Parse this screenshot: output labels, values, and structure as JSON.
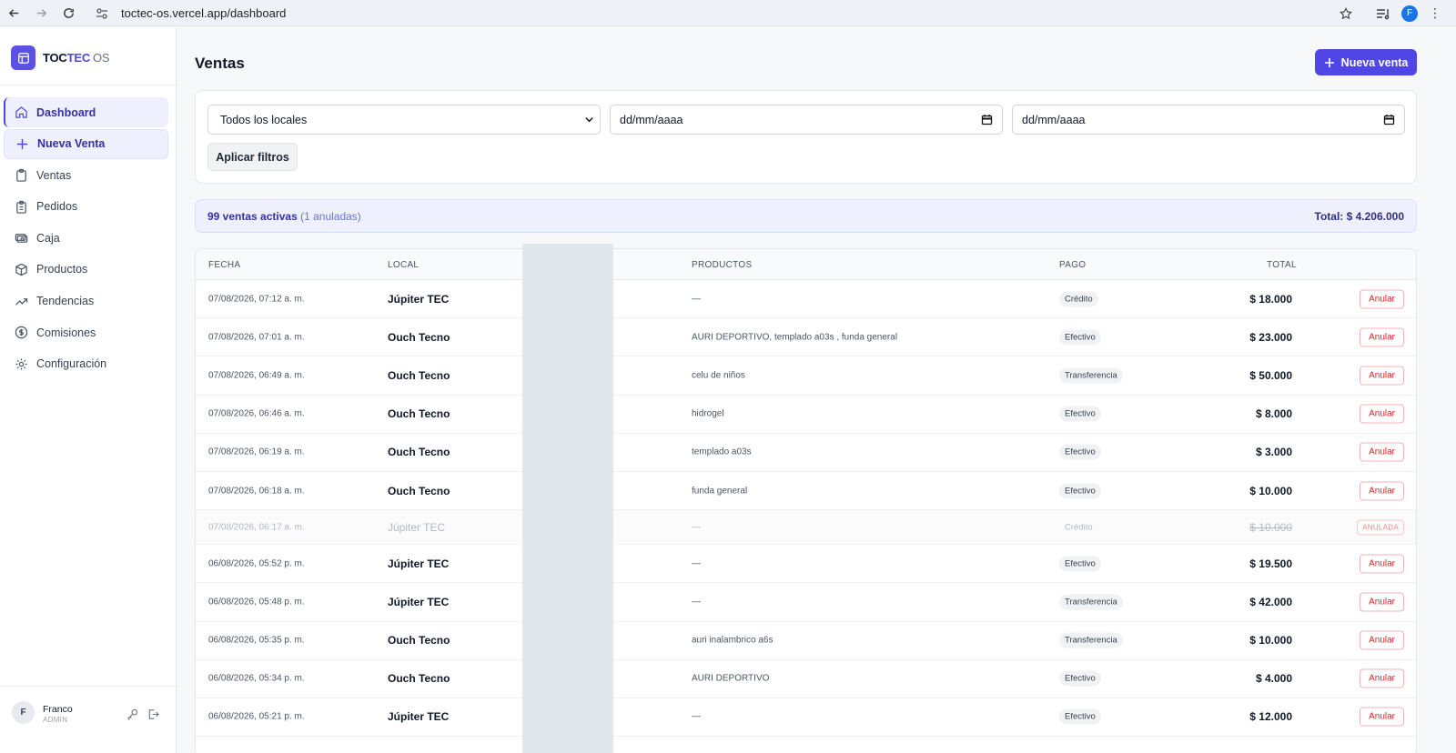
{
  "browser": {
    "url": "toctec-os.vercel.app/dashboard",
    "profile_initial": "F"
  },
  "brand": {
    "name_a": "TOC",
    "name_b": "TEC",
    "suffix": "OS"
  },
  "sidebar": {
    "items": [
      {
        "label": "Dashboard",
        "icon": "home-icon"
      },
      {
        "label": "Nueva Venta",
        "icon": "plus-icon"
      },
      {
        "label": "Ventas",
        "icon": "clipboard-icon"
      },
      {
        "label": "Pedidos",
        "icon": "clipboard-list-icon"
      },
      {
        "label": "Caja",
        "icon": "cash-icon"
      },
      {
        "label": "Productos",
        "icon": "box-icon"
      },
      {
        "label": "Tendencias",
        "icon": "trending-icon"
      },
      {
        "label": "Comisiones",
        "icon": "dollar-circle-icon"
      },
      {
        "label": "Configuración",
        "icon": "gear-icon"
      }
    ],
    "user": {
      "initial": "F",
      "name": "Franco",
      "role": "ADMIN"
    }
  },
  "page": {
    "title": "Ventas",
    "new_sale_label": "Nueva venta"
  },
  "filters": {
    "local_select": "Todos los locales",
    "date_from": "dd/mm/aaaa",
    "date_to": "dd/mm/aaaa",
    "apply_label": "Aplicar filtros"
  },
  "summary": {
    "count_text": "99 ventas activas",
    "voided_text": "(1 anuladas)",
    "total_text": "Total: $ 4.206.000"
  },
  "table": {
    "headers": {
      "date": "FECHA",
      "local": "LOCAL",
      "products": "PRODUCTOS",
      "payment": "PAGO",
      "total": "TOTAL"
    },
    "action_label": "Anular",
    "voided_label": "ANULADA",
    "rows": [
      {
        "date": "07/08/2026, 07:12 a. m.",
        "local": "Júpiter TEC",
        "products": "—",
        "payment": "Crédito",
        "total": "$ 18.000"
      },
      {
        "date": "07/08/2026, 07:01 a. m.",
        "local": "Ouch Tecno",
        "products": "AURI DEPORTIVO, templado a03s , funda general",
        "payment": "Efectivo",
        "total": "$ 23.000"
      },
      {
        "date": "07/08/2026, 06:49 a. m.",
        "local": "Ouch Tecno",
        "products": "celu de niños",
        "payment": "Transferencia",
        "total": "$ 50.000"
      },
      {
        "date": "07/08/2026, 06:46 a. m.",
        "local": "Ouch Tecno",
        "products": "hidrogel",
        "payment": "Efectivo",
        "total": "$ 8.000"
      },
      {
        "date": "07/08/2026, 06:19 a. m.",
        "local": "Ouch Tecno",
        "products": "templado a03s",
        "payment": "Efectivo",
        "total": "$ 3.000"
      },
      {
        "date": "07/08/2026, 06:18 a. m.",
        "local": "Ouch Tecno",
        "products": "funda general",
        "payment": "Efectivo",
        "total": "$ 10.000"
      },
      {
        "date": "07/08/2026, 06:17 a. m.",
        "local": "Júpiter TEC",
        "products": "—",
        "payment": "Crédito",
        "total": "$ 10.000"
      },
      {
        "date": "06/08/2026, 05:52 p. m.",
        "local": "Júpiter TEC",
        "products": "—",
        "payment": "Efectivo",
        "total": "$ 19.500"
      },
      {
        "date": "06/08/2026, 05:48 p. m.",
        "local": "Júpiter TEC",
        "products": "—",
        "payment": "Transferencia",
        "total": "$ 42.000"
      },
      {
        "date": "06/08/2026, 05:35 p. m.",
        "local": "Ouch Tecno",
        "products": "auri inalambrico a6s",
        "payment": "Transferencia",
        "total": "$ 10.000"
      },
      {
        "date": "06/08/2026, 05:34 p. m.",
        "local": "Ouch Tecno",
        "products": "AURI DEPORTIVO",
        "payment": "Efectivo",
        "total": "$ 4.000"
      },
      {
        "date": "06/08/2026, 05:21 p. m.",
        "local": "Júpiter TEC",
        "products": "—",
        "payment": "Efectivo",
        "total": "$ 12.000"
      }
    ]
  },
  "colors": {
    "accent": "#4f46e5",
    "danger": "#dc2626",
    "summary_bg": "#eef1fd"
  }
}
